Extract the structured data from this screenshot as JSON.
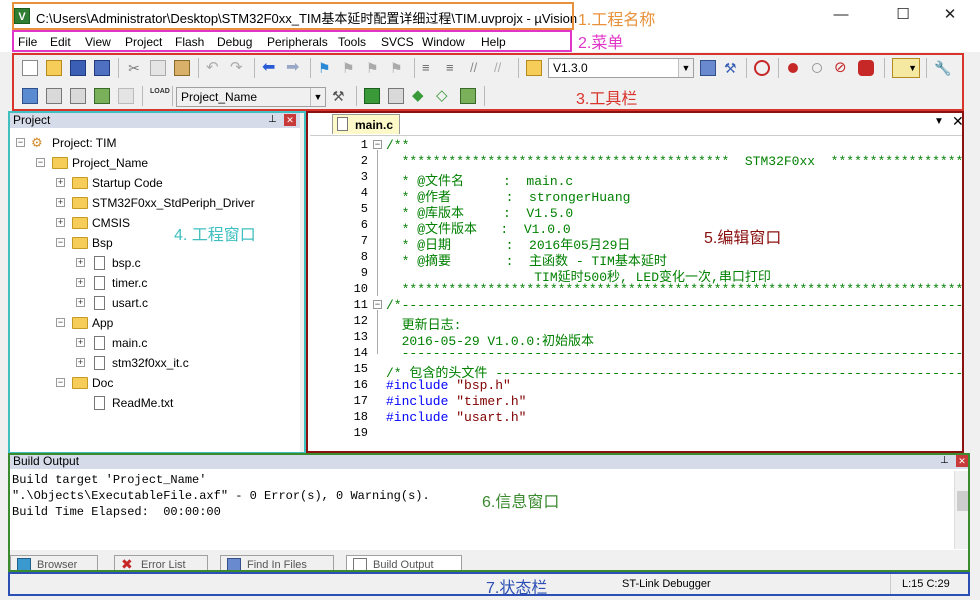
{
  "window": {
    "title": "C:\\Users\\Administrator\\Desktop\\STM32F0xx_TIM基本延时配置详细过程\\TIM.uvprojx - µVision",
    "icon": "uvision-icon",
    "minimize": "—",
    "maximize": "☐",
    "close": "✕"
  },
  "menu": [
    "File",
    "Edit",
    "View",
    "Project",
    "Flash",
    "Debug",
    "Peripherals",
    "Tools",
    "SVCS",
    "Window",
    "Help"
  ],
  "toolbar": {
    "version_combo": "V1.3.0",
    "target_combo": "Project_Name"
  },
  "annotations": {
    "title": "1.工程名称",
    "menu": "2.菜单",
    "toolbar": "3.工具栏",
    "project": "4. 工程窗口",
    "editor": "5.编辑窗口",
    "output": "6.信息窗口",
    "status": "7.状态栏"
  },
  "project_panel": {
    "title": "Project",
    "tree": [
      {
        "label": "Project: TIM",
        "type": "project",
        "level": 0,
        "expander": "−"
      },
      {
        "label": "Project_Name",
        "type": "folder",
        "level": 1,
        "expander": "−"
      },
      {
        "label": "Startup Code",
        "type": "folder",
        "level": 2,
        "expander": "+"
      },
      {
        "label": "STM32F0xx_StdPeriph_Driver",
        "type": "folder",
        "level": 2,
        "expander": "+"
      },
      {
        "label": "CMSIS",
        "type": "folder",
        "level": 2,
        "expander": "+"
      },
      {
        "label": "Bsp",
        "type": "folder",
        "level": 2,
        "expander": "−"
      },
      {
        "label": "bsp.c",
        "type": "file",
        "level": 3,
        "expander": "+"
      },
      {
        "label": "timer.c",
        "type": "file",
        "level": 3,
        "expander": "+"
      },
      {
        "label": "usart.c",
        "type": "file",
        "level": 3,
        "expander": "+"
      },
      {
        "label": "App",
        "type": "folder",
        "level": 2,
        "expander": "−"
      },
      {
        "label": "main.c",
        "type": "file",
        "level": 3,
        "expander": "+"
      },
      {
        "label": "stm32f0xx_it.c",
        "type": "file",
        "level": 3,
        "expander": "+"
      },
      {
        "label": "Doc",
        "type": "folder",
        "level": 2,
        "expander": "−"
      },
      {
        "label": "ReadMe.txt",
        "type": "file",
        "level": 3,
        "expander": ""
      }
    ]
  },
  "editor": {
    "tab": "main.c",
    "lines": [
      {
        "n": "1",
        "text": "/**",
        "cls": "green"
      },
      {
        "n": "2",
        "text": "  ******************************************  STM32F0xx  **************************",
        "cls": "green"
      },
      {
        "n": "3",
        "text": "  * @文件名     :  main.c",
        "cls": "green"
      },
      {
        "n": "4",
        "text": "  * @作者       :  strongerHuang",
        "cls": "green"
      },
      {
        "n": "5",
        "text": "  * @库版本     :  V1.5.0",
        "cls": "green"
      },
      {
        "n": "6",
        "text": "  * @文件版本   :  V1.0.0",
        "cls": "green"
      },
      {
        "n": "7",
        "text": "  * @日期       :  2016年05月29日",
        "cls": "green"
      },
      {
        "n": "8",
        "text": "  * @摘要       :  主函数 - TIM基本延时",
        "cls": "green"
      },
      {
        "n": "9",
        "text": "                   TIM延时500秒, LED变化一次,串口打印",
        "cls": "green"
      },
      {
        "n": "10",
        "text": "  ******************************************************************************",
        "cls": "green"
      },
      {
        "n": "11",
        "text": "/*-----------------------------------------------------------------------------",
        "cls": "green"
      },
      {
        "n": "12",
        "text": "  更新日志:",
        "cls": "green"
      },
      {
        "n": "13",
        "text": "  2016-05-29 V1.0.0:初始版本",
        "cls": "green"
      },
      {
        "n": "14",
        "text": "  -----------------------------------------------------------------------------",
        "cls": "green"
      },
      {
        "n": "15",
        "text": "/* 包含的头文件 ----------------------------------------------------------------",
        "cls": "green"
      },
      {
        "n": "16",
        "text": "#include \"bsp.h\"",
        "cls": "pre"
      },
      {
        "n": "17",
        "text": "#include \"timer.h\"",
        "cls": "pre"
      },
      {
        "n": "18",
        "text": "#include \"usart.h\"",
        "cls": "pre"
      },
      {
        "n": "19",
        "text": "",
        "cls": ""
      }
    ]
  },
  "output_panel": {
    "title": "Build Output",
    "lines": [
      "Build target 'Project_Name'",
      "\".\\Objects\\ExecutableFile.axf\" - 0 Error(s), 0 Warning(s).",
      "Build Time Elapsed:  00:00:00"
    ]
  },
  "bottom_tabs": [
    "Browser",
    "Error List",
    "Find In Files",
    "Build Output"
  ],
  "status": {
    "debugger": "ST-Link Debugger",
    "cursor": "L:15 C:29"
  },
  "colors": {
    "title_box": "#e8913a",
    "menu_box": "#e035c8",
    "toolbar_box": "#d9342b",
    "project_box": "#3fbfbf",
    "editor_box": "#8b1010",
    "output_box": "#3a8a2e",
    "status_box": "#2b4fb5"
  }
}
